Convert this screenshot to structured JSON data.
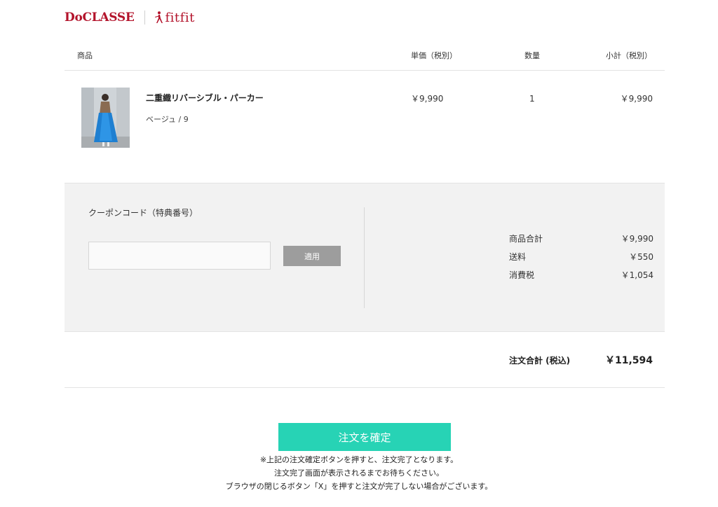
{
  "header": {
    "brand_primary": "DoCLASSE",
    "brand_secondary": "fitfit",
    "brand_color": "#b3132b"
  },
  "table": {
    "columns": [
      "商品",
      "単価（税別）",
      "数量",
      "小計（税別）"
    ]
  },
  "item": {
    "name": "二重織リバーシブル・パーカー",
    "variant": "ベージュ / 9",
    "unit_price": "￥9,990",
    "quantity": "1",
    "subtotal": "￥9,990"
  },
  "coupon": {
    "label": "クーポンコード（特典番号）",
    "value": "",
    "placeholder": "",
    "apply_label": "適用"
  },
  "totals": [
    {
      "label": "商品合計",
      "value": "￥9,990"
    },
    {
      "label": "送料",
      "value": "￥550"
    },
    {
      "label": "消費税",
      "value": "￥1,054"
    }
  ],
  "grand_total": {
    "label": "注文合計 (税込)",
    "value": "￥11,594"
  },
  "confirm": {
    "label": "注文を確定",
    "color": "#27d3b5",
    "notes": [
      "※上記の注文確定ボタンを押すと、注文完了となります。",
      "注文完了画面が表示されるまでお待ちください。",
      "ブラウザの閉じるボタン「X」を押すと注文が完了しない場合がございます。"
    ]
  }
}
